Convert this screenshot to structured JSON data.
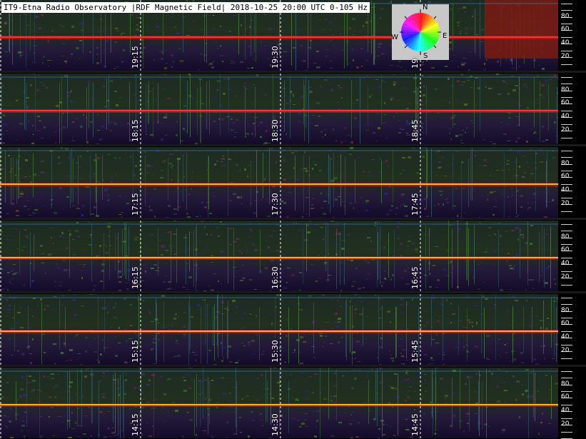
{
  "header": {
    "title": "IT9-Etna Radio Observatory |RDF Magnetic Field| 2018-10-25 20:00 UTC 0-105 Hz"
  },
  "compass": {
    "north": "N",
    "south": "S",
    "east": "E",
    "west": "W",
    "icon": "compass-wheel-icon"
  },
  "frequency_scale": {
    "labels": [
      "80",
      "60",
      "40",
      "20"
    ],
    "unit": "Hz",
    "range": [
      0,
      105
    ]
  },
  "strips": [
    {
      "times": [
        "19:15",
        "19:30",
        "19:"
      ]
    },
    {
      "times": [
        "18:15",
        "18:30",
        "18:45"
      ]
    },
    {
      "times": [
        "17:15",
        "17:30",
        "17:45"
      ]
    },
    {
      "times": [
        "16:15",
        "16:30",
        "16:45"
      ]
    },
    {
      "times": [
        "15:15",
        "15:30",
        "15:45"
      ]
    },
    {
      "times": [
        "14:15",
        "14:30",
        "14:45"
      ]
    }
  ],
  "colors": {
    "background": "#120f2a",
    "hum_line": "#ff4a1a",
    "noise_green": "#3f7a2a",
    "title_bg": "#ffffff"
  }
}
